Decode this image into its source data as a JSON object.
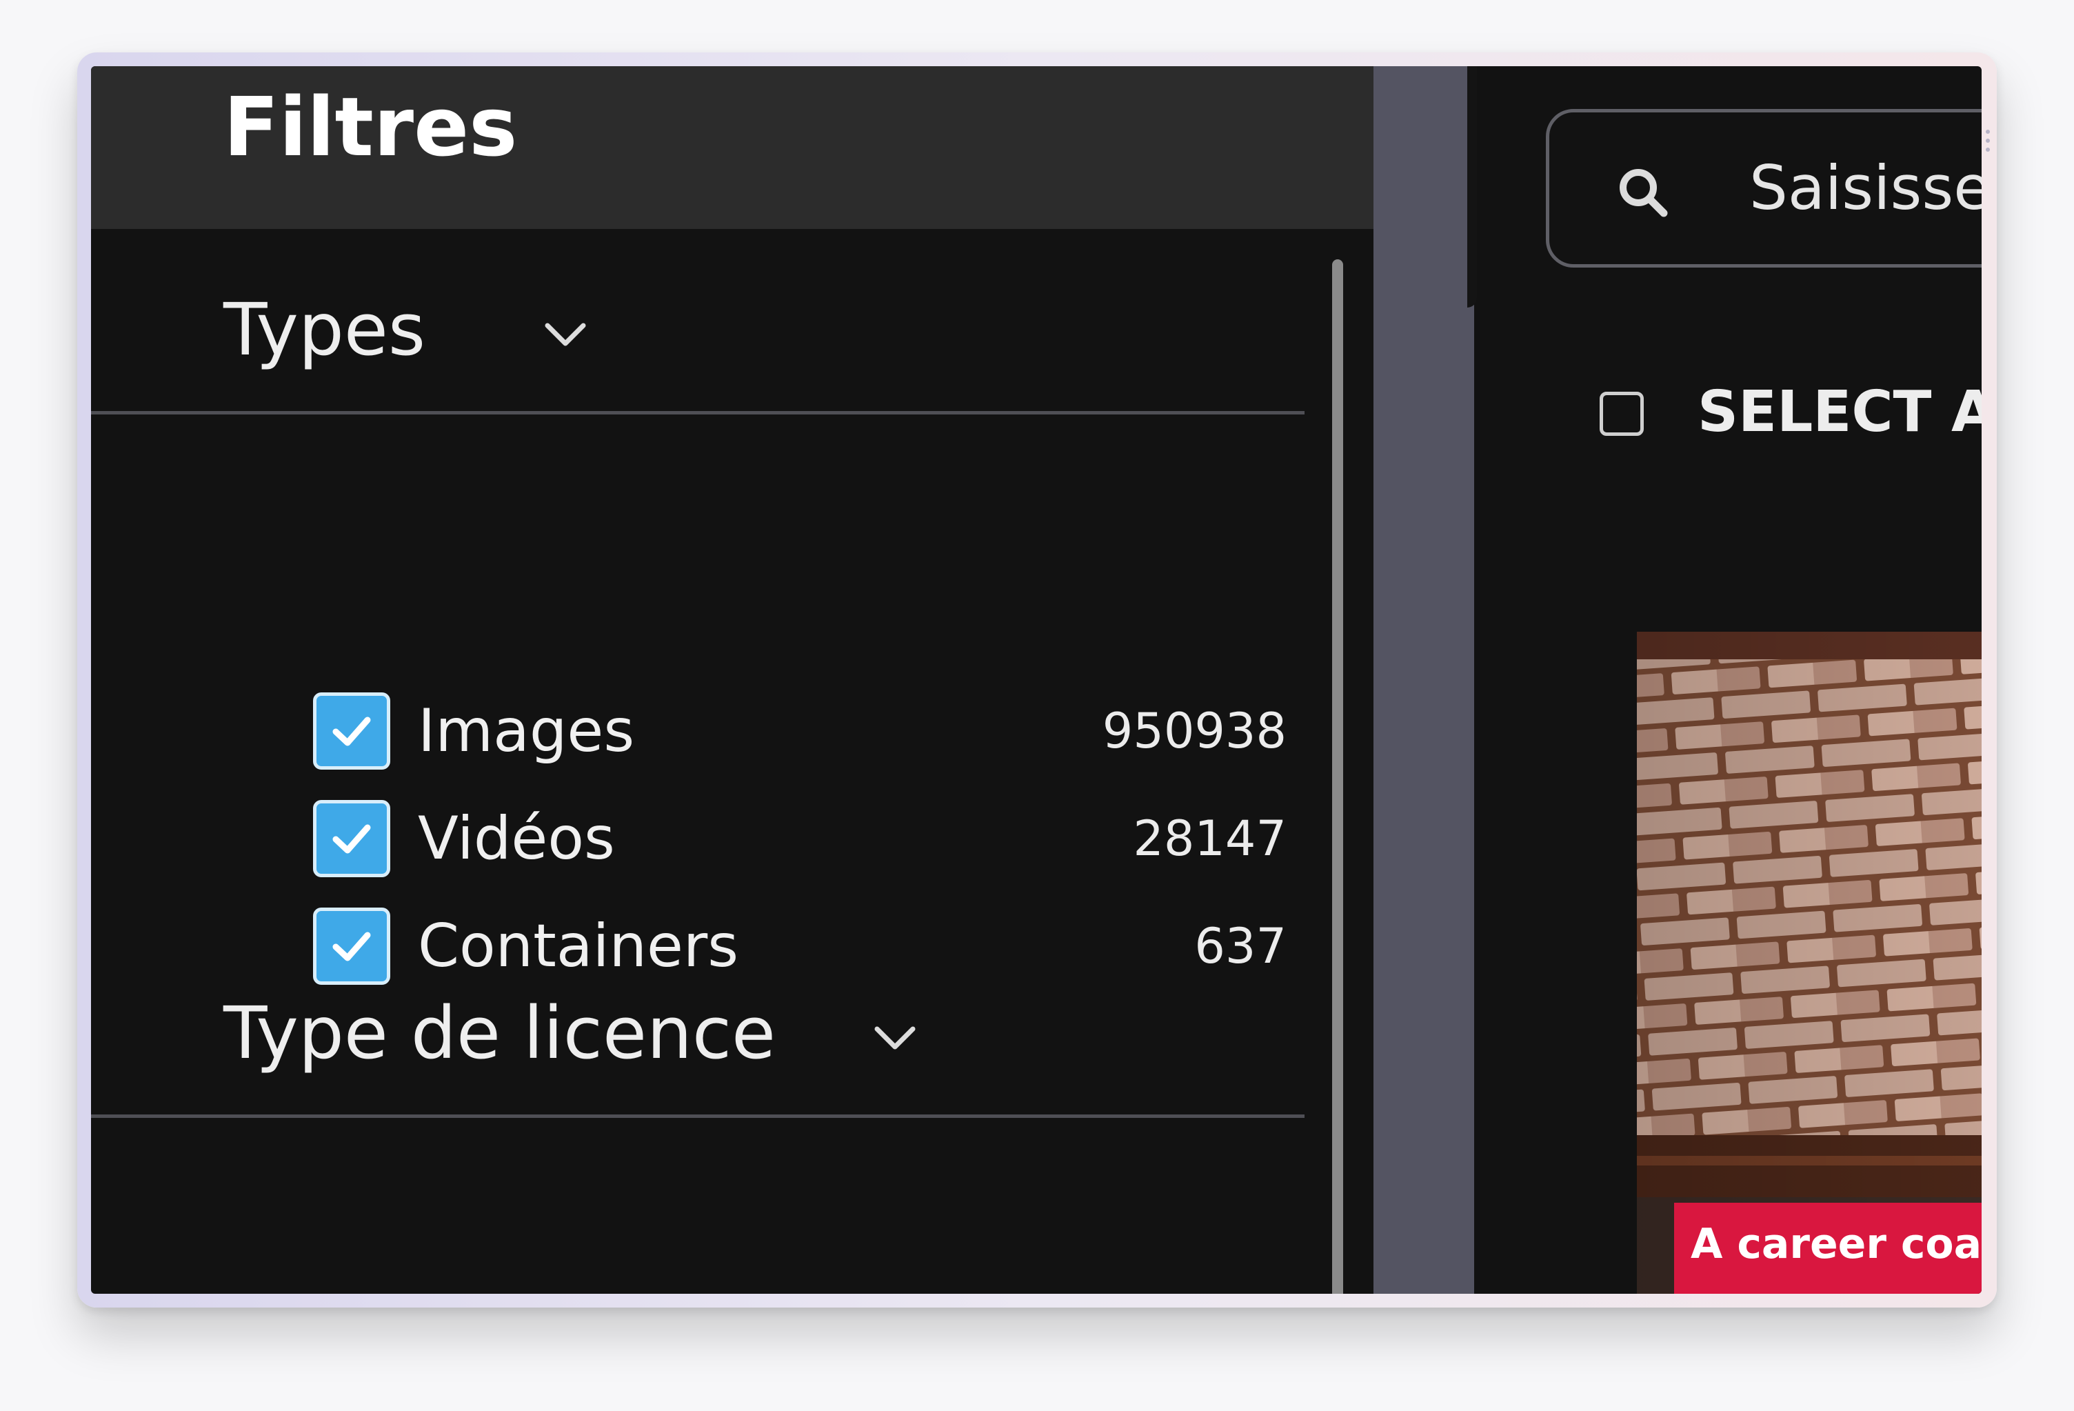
{
  "filters": {
    "title": "Filtres",
    "types_section": {
      "title": "Types",
      "items": [
        {
          "label": "Images",
          "count": "950938",
          "checked": true
        },
        {
          "label": "Vidéos",
          "count": "28147",
          "checked": true
        },
        {
          "label": "Containers",
          "count": "637",
          "checked": true
        }
      ]
    },
    "license_section": {
      "title": "Type de licence"
    }
  },
  "search": {
    "placeholder": "Saisissez",
    "icon": "search-icon"
  },
  "results": {
    "select_all_label": "SELECT ALL",
    "select_all_checked": false,
    "thumbnail_caption": "A career coach s"
  },
  "colors": {
    "checkbox_accent": "#3fa9e8",
    "caption_bg": "#d9173f",
    "panel_bg": "#121212",
    "header_bg": "#2c2c2c",
    "gutter": "#545462"
  }
}
